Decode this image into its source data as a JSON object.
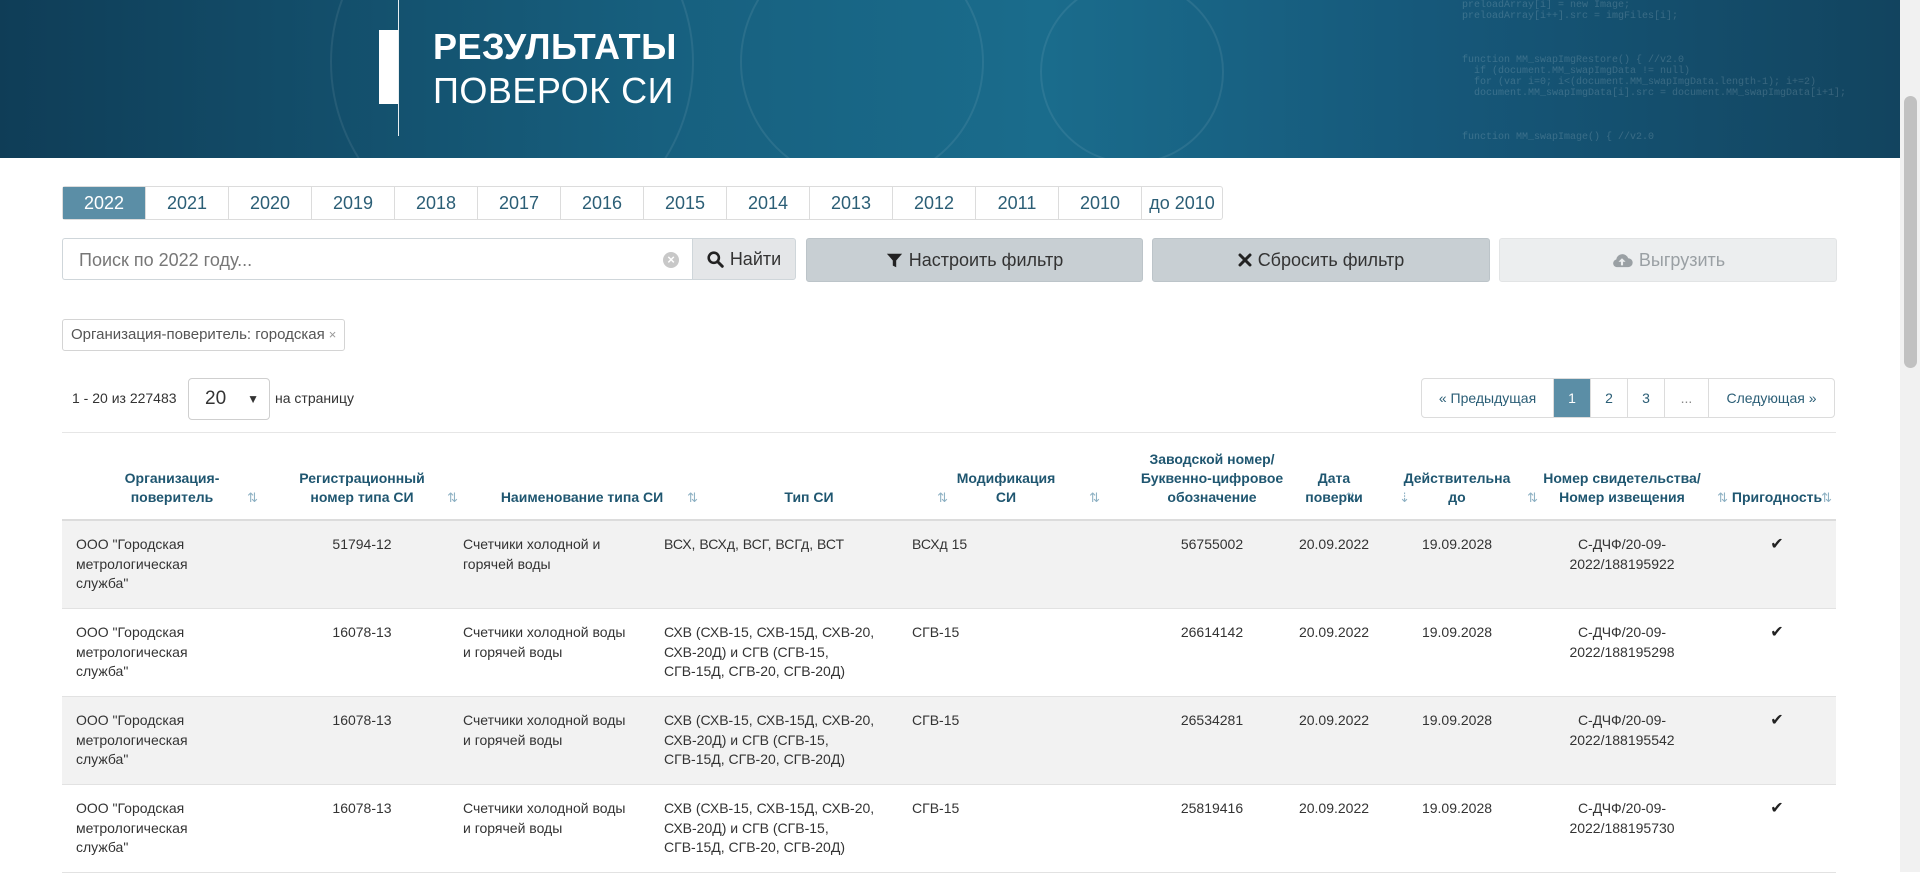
{
  "header": {
    "title_line1": "РЕЗУЛЬТАТЫ",
    "title_line2": "ПОВЕРОК СИ",
    "deco_code": "preloadArray[i] = new Image;\npreloadArray[i++].src = imgFiles[i];\n\n\n\nfunction MM_swapImgRestore() { //v2.0\n  if (document.MM_swapImgData != null)\n  for (var i=0; i<(document.MM_swapImgData.length-1); i+=2)\n  document.MM_swapImgData[i].src = document.MM_swapImgData[i+1];\n\n\n\nfunction MM_swapImage() { //v2.0"
  },
  "years": [
    "2022",
    "2021",
    "2020",
    "2019",
    "2018",
    "2017",
    "2016",
    "2015",
    "2014",
    "2013",
    "2012",
    "2011",
    "2010",
    "до 2010"
  ],
  "active_year": "2022",
  "search": {
    "placeholder": "Поиск по 2022 году...",
    "find_label": "Найти",
    "configure_filter_label": "Настроить фильтр",
    "reset_filter_label": "Сбросить фильтр",
    "export_label": "Выгрузить"
  },
  "filter_chip": {
    "label": "Организация-поверитель: городская",
    "remove": "×"
  },
  "paging": {
    "count_text": "1 - 20 из 227483",
    "per_page_value": "20",
    "per_page_label": "на страницу",
    "prev_label": "Предыдущая",
    "pages": [
      "1",
      "2",
      "3",
      "..."
    ],
    "active_page": "1",
    "next_label": "Следующая"
  },
  "table": {
    "columns": [
      {
        "label": "Организация-\nповеритель",
        "sort": "⇅"
      },
      {
        "label": "Регистрационный\nномер типа СИ",
        "sort": "⇅"
      },
      {
        "label": "Наименование типа СИ",
        "sort": "⇅"
      },
      {
        "label": "Тип СИ",
        "sort": "⇅"
      },
      {
        "label": "Модификация\nСИ",
        "sort": "⇅"
      },
      {
        "label": "Заводской номер/\nБуквенно-цифровое\nобозначение",
        "sort": "⇅"
      },
      {
        "label": "Дата\nповерки",
        "sort": "⇣"
      },
      {
        "label": "Действительна\nдо",
        "sort": "⇅"
      },
      {
        "label": "Номер свидетельства/\nНомер извещения",
        "sort": "⇅"
      },
      {
        "label": "Пригодность",
        "sort": "⇅"
      }
    ],
    "rows": [
      {
        "org": "ООО \"Городская\nметрологическая\nслужба\"",
        "reg": "51794-12",
        "name": "Счетчики холодной и\nгорячей воды",
        "type": "ВСХ, ВСХд, ВСГ, ВСГд, ВСТ",
        "mod": "ВСХд 15",
        "serial": "56755002",
        "date": "20.09.2022",
        "valid": "19.09.2028",
        "cert": "С-ДЧФ/20-09-\n2022/188195922",
        "ok": "✔"
      },
      {
        "org": "ООО \"Городская\nметрологическая\nслужба\"",
        "reg": "16078-13",
        "name": "Счетчики холодной воды\nи горячей воды",
        "type": "СХВ (СХВ-15, СХВ-15Д, СХВ-20,\nСХВ-20Д) и СГВ (СГВ-15,\nСГВ-15Д, СГВ-20, СГВ-20Д)",
        "mod": "СГВ-15",
        "serial": "26614142",
        "date": "20.09.2022",
        "valid": "19.09.2028",
        "cert": "С-ДЧФ/20-09-\n2022/188195298",
        "ok": "✔"
      },
      {
        "org": "ООО \"Городская\nметрологическая\nслужба\"",
        "reg": "16078-13",
        "name": "Счетчики холодной воды\nи горячей воды",
        "type": "СХВ (СХВ-15, СХВ-15Д, СХВ-20,\nСХВ-20Д) и СГВ (СГВ-15,\nСГВ-15Д, СГВ-20, СГВ-20Д)",
        "mod": "СГВ-15",
        "serial": "26534281",
        "date": "20.09.2022",
        "valid": "19.09.2028",
        "cert": "С-ДЧФ/20-09-\n2022/188195542",
        "ok": "✔"
      },
      {
        "org": "ООО \"Городская\nметрологическая\nслужба\"",
        "reg": "16078-13",
        "name": "Счетчики холодной воды\nи горячей воды",
        "type": "СХВ (СХВ-15, СХВ-15Д, СХВ-20,\nСХВ-20Д) и СГВ (СГВ-15,\nСГВ-15Д, СГВ-20, СГВ-20Д)",
        "mod": "СГВ-15",
        "serial": "25819416",
        "date": "20.09.2022",
        "valid": "19.09.2028",
        "cert": "С-ДЧФ/20-09-\n2022/188195730",
        "ok": "✔"
      }
    ]
  },
  "icons": {
    "search": "search-icon",
    "filter": "filter-icon",
    "reset": "close-icon",
    "export": "cloud-upload-icon",
    "valid": "check-icon"
  },
  "colors": {
    "accent": "#5b8ea6",
    "header_text": "#1f5670",
    "banner_dark": "#0f3d57"
  }
}
